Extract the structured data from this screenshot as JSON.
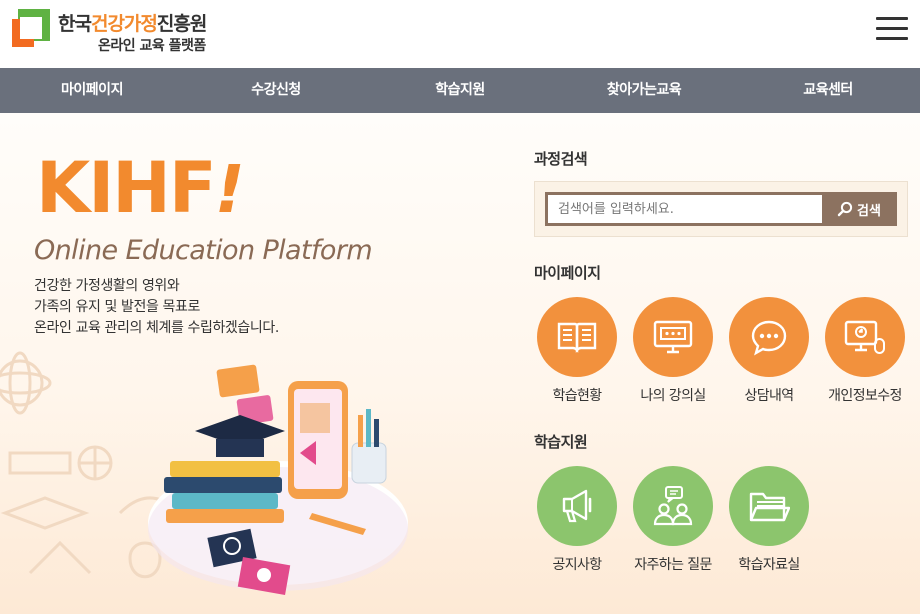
{
  "header": {
    "logo_title_prefix": "한국",
    "logo_title_accent": "건강가정",
    "logo_title_suffix": "진흥원",
    "logo_subtitle": "온라인 교육 플랫폼"
  },
  "nav": {
    "items": [
      {
        "label": "마이페이지"
      },
      {
        "label": "수강신청"
      },
      {
        "label": "학습지원"
      },
      {
        "label": "찾아가는교육"
      },
      {
        "label": "교육센터"
      }
    ]
  },
  "hero": {
    "brand": "KIHF",
    "brand_mark": "!",
    "subtitle": "Online Education Platform",
    "description": [
      "건강한 가정생활의 영위와",
      "가족의 유지 및 발전을 목표로",
      "온라인 교육 관리의 체계를 수립하겠습니다."
    ]
  },
  "search": {
    "title": "과정검색",
    "placeholder": "검색어를 입력하세요.",
    "button_label": "검색"
  },
  "mypage": {
    "title": "마이페이지",
    "tiles": [
      {
        "label": "학습현황",
        "icon": "book-icon"
      },
      {
        "label": "나의 강의실",
        "icon": "monitor-icon"
      },
      {
        "label": "상담내역",
        "icon": "chat-icon"
      },
      {
        "label": "개인정보수정",
        "icon": "computer-user-icon"
      }
    ]
  },
  "support": {
    "title": "학습지원",
    "tiles": [
      {
        "label": "공지사항",
        "icon": "megaphone-icon"
      },
      {
        "label": "자주하는 질문",
        "icon": "faq-people-icon"
      },
      {
        "label": "학습자료실",
        "icon": "folder-icon"
      }
    ]
  },
  "colors": {
    "brand_orange": "#f28a2e",
    "brand_green": "#5fb243",
    "nav_bg": "#6a707c",
    "circle_orange": "#f2913d",
    "circle_green": "#8cc56d",
    "search_frame": "#8c7260"
  }
}
